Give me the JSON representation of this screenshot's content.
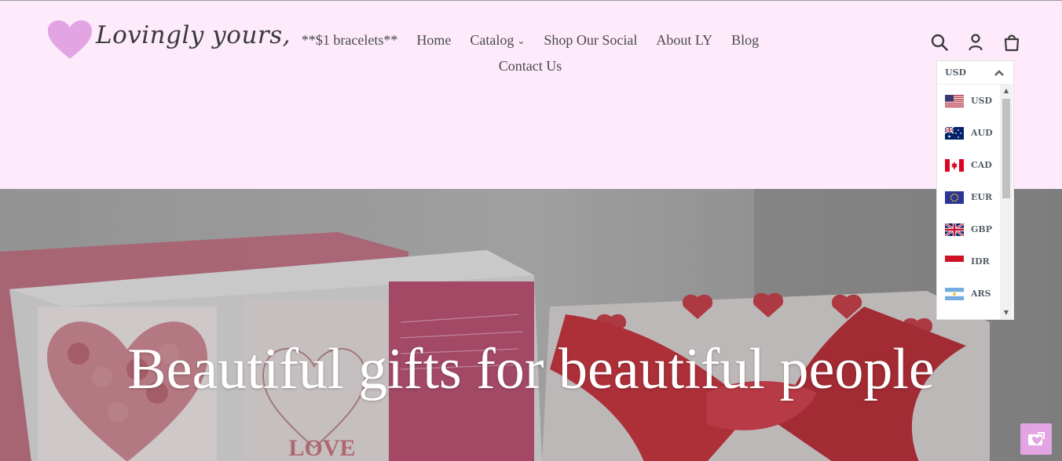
{
  "brand": {
    "name": "Lovingly yours,",
    "heart_color": "#e3a4e3"
  },
  "nav": {
    "items": [
      {
        "label": "**$1 bracelets**"
      },
      {
        "label": "Home"
      },
      {
        "label": "Catalog",
        "has_dropdown": true
      },
      {
        "label": "Shop Our Social"
      },
      {
        "label": "About LY"
      },
      {
        "label": "Blog"
      }
    ],
    "second_row": {
      "label": "Contact Us"
    }
  },
  "header_icons": [
    "search-icon",
    "account-icon",
    "cart-icon"
  ],
  "currency": {
    "selected": "USD",
    "options": [
      {
        "code": "USD",
        "flag": "us-flag-icon"
      },
      {
        "code": "AUD",
        "flag": "au-flag-icon"
      },
      {
        "code": "CAD",
        "flag": "ca-flag-icon"
      },
      {
        "code": "EUR",
        "flag": "eu-flag-icon"
      },
      {
        "code": "GBP",
        "flag": "gb-flag-icon"
      },
      {
        "code": "IDR",
        "flag": "id-flag-icon"
      },
      {
        "code": "ARS",
        "flag": "ar-flag-icon"
      }
    ]
  },
  "hero": {
    "title": "Beautiful gifts for beautiful people"
  },
  "colors": {
    "header_bg": "#fdeafb",
    "accent": "#e3a4e3",
    "text": "#4a4a4a"
  }
}
